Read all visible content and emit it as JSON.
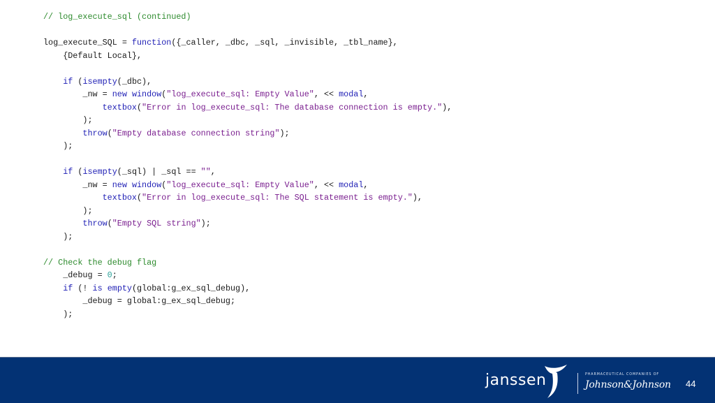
{
  "code": {
    "lines": [
      [
        {
          "t": "// log_execute_sql (continued)",
          "c": "comment"
        }
      ],
      [],
      [
        {
          "t": "log_execute_SQL = ",
          "c": "plain"
        },
        {
          "t": "function",
          "c": "keyword"
        },
        {
          "t": "({_caller, _dbc, _sql, _invisible, _tbl_name},",
          "c": "plain"
        }
      ],
      [
        {
          "t": "    {Default Local},",
          "c": "plain"
        }
      ],
      [],
      [
        {
          "t": "    ",
          "c": "plain"
        },
        {
          "t": "if",
          "c": "keyword"
        },
        {
          "t": " (",
          "c": "plain"
        },
        {
          "t": "isempty",
          "c": "keyword"
        },
        {
          "t": "(_dbc),",
          "c": "plain"
        }
      ],
      [
        {
          "t": "        _nw = ",
          "c": "plain"
        },
        {
          "t": "new",
          "c": "keyword"
        },
        {
          "t": " ",
          "c": "plain"
        },
        {
          "t": "window",
          "c": "keyword"
        },
        {
          "t": "(",
          "c": "plain"
        },
        {
          "t": "\"log_execute_sql: Empty Value\"",
          "c": "string"
        },
        {
          "t": ", << ",
          "c": "plain"
        },
        {
          "t": "modal",
          "c": "keyword"
        },
        {
          "t": ",",
          "c": "plain"
        }
      ],
      [
        {
          "t": "            ",
          "c": "plain"
        },
        {
          "t": "textbox",
          "c": "keyword"
        },
        {
          "t": "(",
          "c": "plain"
        },
        {
          "t": "\"Error in log_execute_sql: The database connection is empty.\"",
          "c": "string"
        },
        {
          "t": "),",
          "c": "plain"
        }
      ],
      [
        {
          "t": "        );",
          "c": "plain"
        }
      ],
      [
        {
          "t": "        ",
          "c": "plain"
        },
        {
          "t": "throw",
          "c": "keyword"
        },
        {
          "t": "(",
          "c": "plain"
        },
        {
          "t": "\"Empty database connection string\"",
          "c": "string"
        },
        {
          "t": ");",
          "c": "plain"
        }
      ],
      [
        {
          "t": "    );",
          "c": "plain"
        }
      ],
      [],
      [
        {
          "t": "    ",
          "c": "plain"
        },
        {
          "t": "if",
          "c": "keyword"
        },
        {
          "t": " (",
          "c": "plain"
        },
        {
          "t": "isempty",
          "c": "keyword"
        },
        {
          "t": "(_sql) | _sql == ",
          "c": "plain"
        },
        {
          "t": "\"\"",
          "c": "string"
        },
        {
          "t": ",",
          "c": "plain"
        }
      ],
      [
        {
          "t": "        _nw = ",
          "c": "plain"
        },
        {
          "t": "new",
          "c": "keyword"
        },
        {
          "t": " ",
          "c": "plain"
        },
        {
          "t": "window",
          "c": "keyword"
        },
        {
          "t": "(",
          "c": "plain"
        },
        {
          "t": "\"log_execute_sql: Empty Value\"",
          "c": "string"
        },
        {
          "t": ", << ",
          "c": "plain"
        },
        {
          "t": "modal",
          "c": "keyword"
        },
        {
          "t": ",",
          "c": "plain"
        }
      ],
      [
        {
          "t": "            ",
          "c": "plain"
        },
        {
          "t": "textbox",
          "c": "keyword"
        },
        {
          "t": "(",
          "c": "plain"
        },
        {
          "t": "\"Error in log_execute_sql: The SQL statement is empty.\"",
          "c": "string"
        },
        {
          "t": "),",
          "c": "plain"
        }
      ],
      [
        {
          "t": "        );",
          "c": "plain"
        }
      ],
      [
        {
          "t": "        ",
          "c": "plain"
        },
        {
          "t": "throw",
          "c": "keyword"
        },
        {
          "t": "(",
          "c": "plain"
        },
        {
          "t": "\"Empty SQL string\"",
          "c": "string"
        },
        {
          "t": ");",
          "c": "plain"
        }
      ],
      [
        {
          "t": "    );",
          "c": "plain"
        }
      ],
      [],
      [
        {
          "t": "// Check the debug flag",
          "c": "comment"
        }
      ],
      [
        {
          "t": "    _debug = ",
          "c": "plain"
        },
        {
          "t": "0",
          "c": "number"
        },
        {
          "t": ";",
          "c": "plain"
        }
      ],
      [
        {
          "t": "    ",
          "c": "plain"
        },
        {
          "t": "if",
          "c": "keyword"
        },
        {
          "t": " (! ",
          "c": "plain"
        },
        {
          "t": "is",
          "c": "keyword"
        },
        {
          "t": " ",
          "c": "plain"
        },
        {
          "t": "empty",
          "c": "keyword"
        },
        {
          "t": "(global:g_ex_sql_debug),",
          "c": "plain"
        }
      ],
      [
        {
          "t": "        _debug = global:g_ex_sql_debug;",
          "c": "plain"
        }
      ],
      [
        {
          "t": "    );",
          "c": "plain"
        }
      ]
    ]
  },
  "footer": {
    "brand": "janssen",
    "caption": "PHARMACEUTICAL COMPANIES OF",
    "parent_brand": "Johnson&Johnson",
    "page_number": "44"
  },
  "colors": {
    "footer_bg": "#033274",
    "comment": "#2e8b2e",
    "keyword": "#1f1fb5",
    "string": "#7a1f8f",
    "number": "#2aa198"
  }
}
